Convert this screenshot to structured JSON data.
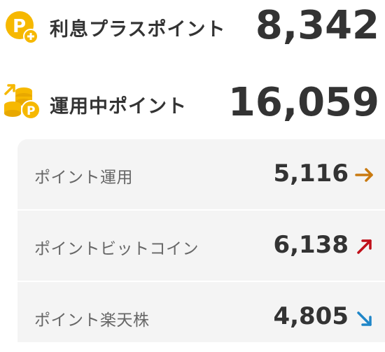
{
  "interest_plus": {
    "label": "利息プラスポイント",
    "value": "8,342",
    "icon": "coin-plus-icon",
    "icon_color": "#f6b800"
  },
  "invested": {
    "label": "運用中ポイント",
    "value": "16,059",
    "icon": "coin-stack-arrow-icon",
    "icon_color": "#f6b800"
  },
  "breakdown": [
    {
      "label": "ポイント運用",
      "value": "5,116",
      "trend": "flat",
      "trend_icon": "arrow-right-icon",
      "trend_color": "#c97a10"
    },
    {
      "label": "ポイントビットコイン",
      "value": "6,138",
      "trend": "up",
      "trend_icon": "arrow-up-right-icon",
      "trend_color": "#c0101a"
    },
    {
      "label": "ポイント楽天株",
      "value": "4,805",
      "trend": "down",
      "trend_icon": "arrow-down-right-icon",
      "trend_color": "#1f86c8"
    }
  ]
}
